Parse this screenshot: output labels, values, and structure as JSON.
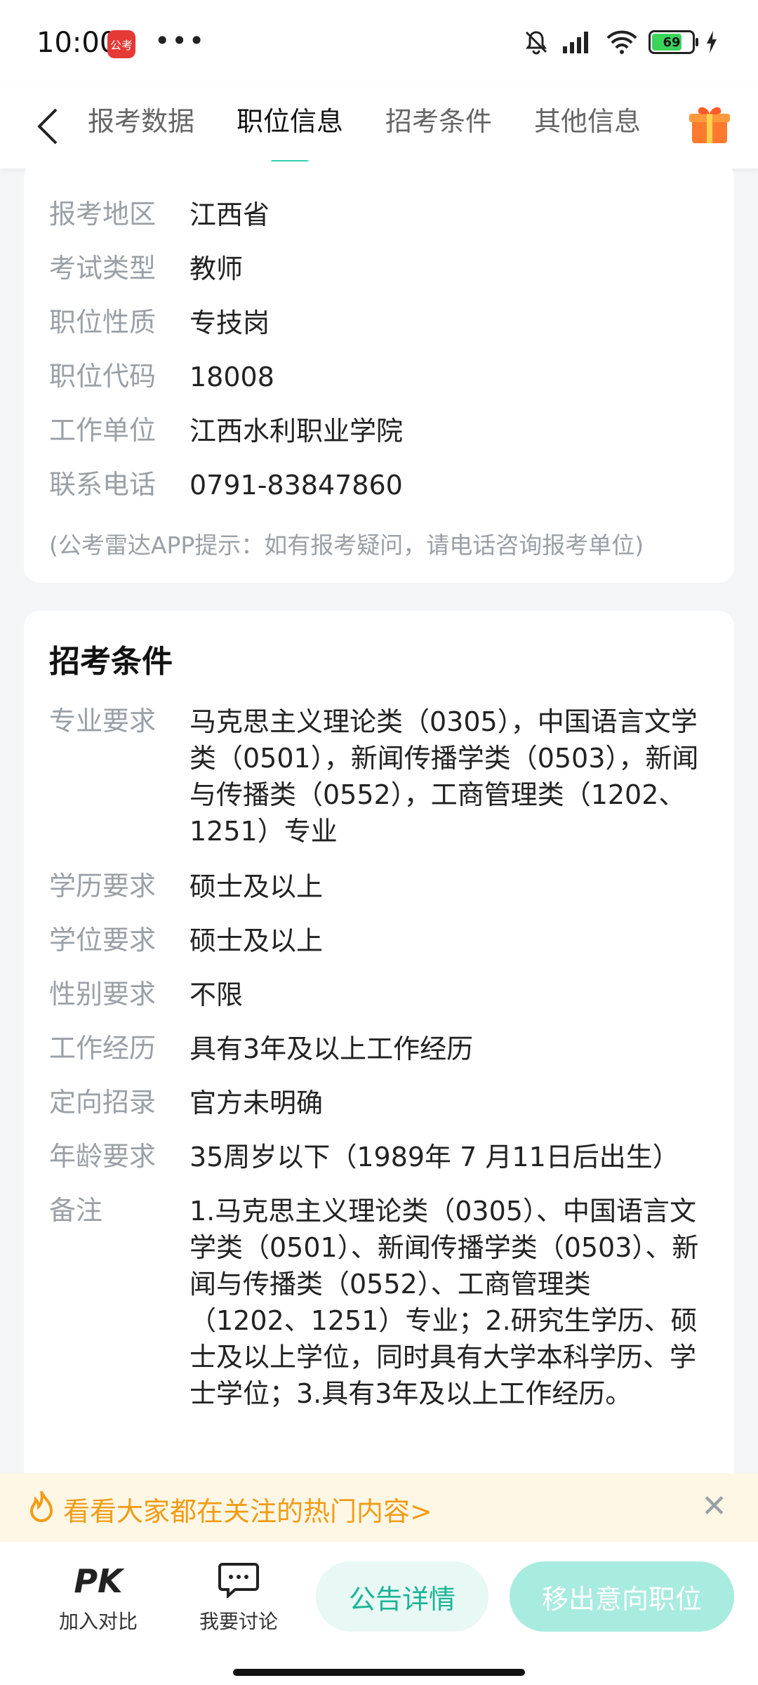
{
  "status": {
    "time": "10:00",
    "app_badge": "公考",
    "dots": "•••",
    "battery": "69"
  },
  "nav": {
    "tabs": [
      {
        "label": "报考数据"
      },
      {
        "label": "职位信息"
      },
      {
        "label": "招考条件"
      },
      {
        "label": "其他信息"
      }
    ],
    "active_tab": 1
  },
  "position_info": {
    "rows": [
      {
        "label": "报考地区",
        "value": "江西省"
      },
      {
        "label": "考试类型",
        "value": "教师"
      },
      {
        "label": "职位性质",
        "value": "专技岗"
      },
      {
        "label": "职位代码",
        "value": "18008"
      },
      {
        "label": "工作单位",
        "value": "江西水利职业学院"
      },
      {
        "label": "联系电话",
        "value": "0791-83847860"
      }
    ],
    "tip": "(公考雷达APP提示：如有报考疑问，请电话咨询报考单位)"
  },
  "conditions": {
    "title": "招考条件",
    "rows": [
      {
        "label": "专业要求",
        "value": "马克思主义理论类（0305），中国语言文学类（0501），新闻传播学类（0503），新闻与传播类（0552），工商管理类（1202、1251）专业"
      },
      {
        "label": "学历要求",
        "value": "硕士及以上"
      },
      {
        "label": "学位要求",
        "value": "硕士及以上"
      },
      {
        "label": "性别要求",
        "value": "不限"
      },
      {
        "label": "工作经历",
        "value": "具有3年及以上工作经历"
      },
      {
        "label": "定向招录",
        "value": "官方未明确"
      },
      {
        "label": "年龄要求",
        "value": "35周岁以下（1989年 7 月11日后出生）"
      },
      {
        "label": "备注",
        "value": "1.马克思主义理论类（0305）、中国语言文学类（0501）、新闻传播学类（0503）、新闻与传播类（0552）、工商管理类（1202、1251）专业；2.研究生学历、硕士及以上学位，同时具有大学本科学历、学士学位；3.具有3年及以上工作经历。"
      }
    ]
  },
  "hot_banner": {
    "text": "看看大家都在关注的热门内容>",
    "close": "✕"
  },
  "bottom": {
    "pk_icon": "PK",
    "pk_label": "加入对比",
    "discuss_label": "我要讨论",
    "notice_button": "公告详情",
    "remove_button": "移出意向职位"
  },
  "colors": {
    "accent": "#33cfb1",
    "hot": "#f19c16"
  }
}
